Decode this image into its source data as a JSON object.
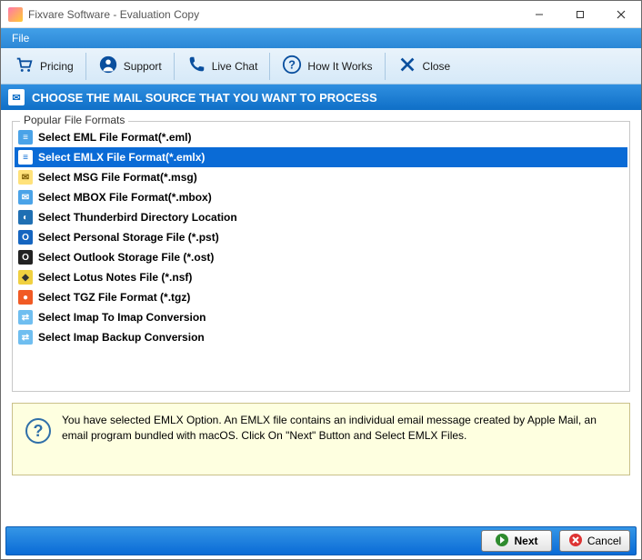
{
  "titlebar": {
    "title": "Fixvare Software - Evaluation Copy"
  },
  "menubar": {
    "file": "File"
  },
  "toolbar": {
    "pricing": "Pricing",
    "support": "Support",
    "livechat": "Live Chat",
    "howitworks": "How It Works",
    "close": "Close"
  },
  "header": {
    "title": "CHOOSE THE MAIL SOURCE THAT YOU WANT TO PROCESS"
  },
  "formats": {
    "legend": "Popular File Formats",
    "items": [
      {
        "label": "Select EML File Format(*.eml)",
        "icon_bg": "#4aa3e8",
        "icon_fg": "#fff",
        "glyph": "≡"
      },
      {
        "label": "Select EMLX File Format(*.emlx)",
        "icon_bg": "#ffffff",
        "icon_fg": "#0a6bd6",
        "glyph": "≡",
        "selected": true
      },
      {
        "label": "Select MSG File Format(*.msg)",
        "icon_bg": "#ffe27a",
        "icon_fg": "#7a5a00",
        "glyph": "✉"
      },
      {
        "label": "Select MBOX File Format(*.mbox)",
        "icon_bg": "#4aa3e8",
        "icon_fg": "#fff",
        "glyph": "✉"
      },
      {
        "label": "Select Thunderbird Directory Location",
        "icon_bg": "#1f6fb3",
        "icon_fg": "#fff",
        "glyph": "◐"
      },
      {
        "label": "Select Personal Storage File (*.pst)",
        "icon_bg": "#1565c0",
        "icon_fg": "#fff",
        "glyph": "O"
      },
      {
        "label": "Select Outlook Storage File (*.ost)",
        "icon_bg": "#222",
        "icon_fg": "#fff",
        "glyph": "O"
      },
      {
        "label": "Select Lotus Notes File (*.nsf)",
        "icon_bg": "#f0d040",
        "icon_fg": "#333",
        "glyph": "◆"
      },
      {
        "label": "Select TGZ File Format (*.tgz)",
        "icon_bg": "#f15a24",
        "icon_fg": "#fff",
        "glyph": "●"
      },
      {
        "label": "Select Imap To Imap Conversion",
        "icon_bg": "#6fbef0",
        "icon_fg": "#fff",
        "glyph": "⇄"
      },
      {
        "label": "Select Imap Backup Conversion",
        "icon_bg": "#6fbef0",
        "icon_fg": "#fff",
        "glyph": "⇄"
      }
    ]
  },
  "info": {
    "text": "You have selected EMLX Option. An EMLX file contains an individual email message created by Apple Mail, an email program bundled with macOS. Click On \"Next\" Button and Select EMLX Files."
  },
  "footer": {
    "next": "Next",
    "cancel": "Cancel"
  }
}
